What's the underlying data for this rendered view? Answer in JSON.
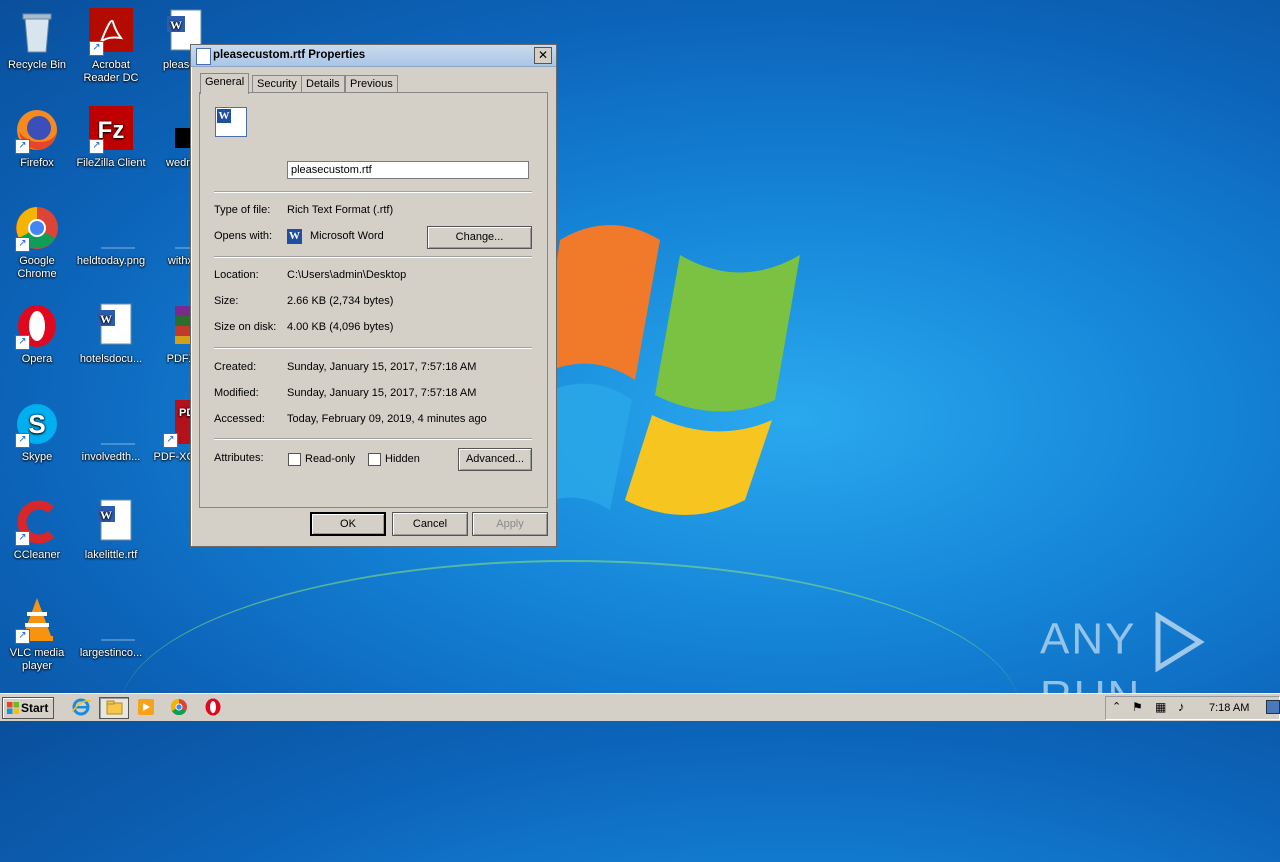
{
  "desktop": {
    "icons": [
      {
        "label": "Recycle Bin",
        "icon": "recycle-bin-icon"
      },
      {
        "label": "Acrobat Reader DC",
        "icon": "acrobat-icon"
      },
      {
        "label": "pleasecu",
        "icon": "word-doc-icon"
      },
      {
        "label": "Firefox",
        "icon": "firefox-icon"
      },
      {
        "label": "FileZilla Client",
        "icon": "filezilla-icon"
      },
      {
        "label": "wednes",
        "icon": "black-file-icon"
      },
      {
        "label": "Google Chrome",
        "icon": "chrome-icon"
      },
      {
        "label": "heldtoday.png",
        "icon": "image-file-icon"
      },
      {
        "label": "withxm",
        "icon": "file-icon"
      },
      {
        "label": "Opera",
        "icon": "opera-icon"
      },
      {
        "label": "hotelsdocu...",
        "icon": "word-doc-icon"
      },
      {
        "label": "PDFXV",
        "icon": "winrar-icon"
      },
      {
        "label": "Skype",
        "icon": "skype-icon"
      },
      {
        "label": "involvedth...",
        "icon": "file-icon"
      },
      {
        "label": "PDF-XC Edit",
        "icon": "pdf-xchange-icon"
      },
      {
        "label": "CCleaner",
        "icon": "ccleaner-icon"
      },
      {
        "label": "lakelittle.rtf",
        "icon": "word-doc-icon"
      },
      {
        "label": "VLC media player",
        "icon": "vlc-icon"
      },
      {
        "label": "largestinco...",
        "icon": "file-icon"
      }
    ]
  },
  "dialog": {
    "title": "pleasecustom.rtf Properties",
    "close_symbol": "✕",
    "tabs": [
      {
        "label": "General",
        "active": true
      },
      {
        "label": "Security",
        "active": false
      },
      {
        "label": "Details",
        "active": false
      },
      {
        "label": "Previous Versions",
        "active": false
      }
    ],
    "filename": "pleasecustom.rtf",
    "type_label": "Type of file:",
    "type_value": "Rich Text Format (.rtf)",
    "opens_label": "Opens with:",
    "opens_value": "Microsoft Word",
    "change_button": "Change...",
    "location_label": "Location:",
    "location_value": "C:\\Users\\admin\\Desktop",
    "size_label": "Size:",
    "size_value": "2.66 KB (2,734 bytes)",
    "size_disk_label": "Size on disk:",
    "size_disk_value": "4.00 KB (4,096 bytes)",
    "created_label": "Created:",
    "created_value": "Sunday, January 15, 2017, 7:57:18 AM",
    "modified_label": "Modified:",
    "modified_value": "Sunday, January 15, 2017, 7:57:18 AM",
    "accessed_label": "Accessed:",
    "accessed_value": "Today, February 09, 2019, 4 minutes ago",
    "attributes_label": "Attributes:",
    "readonly_label": "Read-only",
    "readonly_checked": false,
    "hidden_label": "Hidden",
    "hidden_checked": false,
    "advanced_button": "Advanced...",
    "ok_button": "OK",
    "cancel_button": "Cancel",
    "apply_button": "Apply"
  },
  "taskbar": {
    "start_label": "Start",
    "items": [
      "internet-explorer-icon",
      "explorer-folder-icon",
      "media-player-icon",
      "chrome-icon",
      "opera-icon"
    ],
    "clock": "7:18 AM"
  },
  "watermark": {
    "left": "ANY",
    "right": "RUN"
  }
}
